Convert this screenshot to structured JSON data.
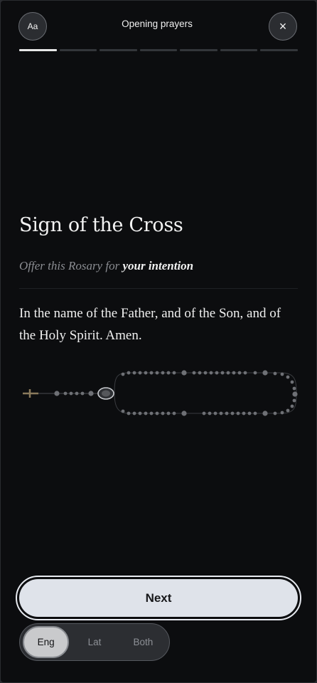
{
  "header": {
    "font_button_label": "Aa",
    "title": "Opening prayers",
    "close_icon": "×"
  },
  "progress": {
    "segments_total": 7,
    "current_segment": 1
  },
  "prayer": {
    "title": "Sign of the Cross",
    "intention_prefix": "Offer this Rosary for ",
    "intention_value": "your intention",
    "text": "In the name of the Father, and of the Son, and of the Holy Spirit. Amen."
  },
  "rosary": {
    "icon": "rosary-beads-illustration"
  },
  "next_button": {
    "label": "Next"
  },
  "language": {
    "options": [
      "Eng",
      "Lat",
      "Both"
    ],
    "selected": "Eng"
  },
  "colors": {
    "background": "#0c0d0f",
    "text_primary": "#f0f0f0",
    "text_muted": "#8b8d92",
    "button_fill": "#dfe3ea"
  }
}
